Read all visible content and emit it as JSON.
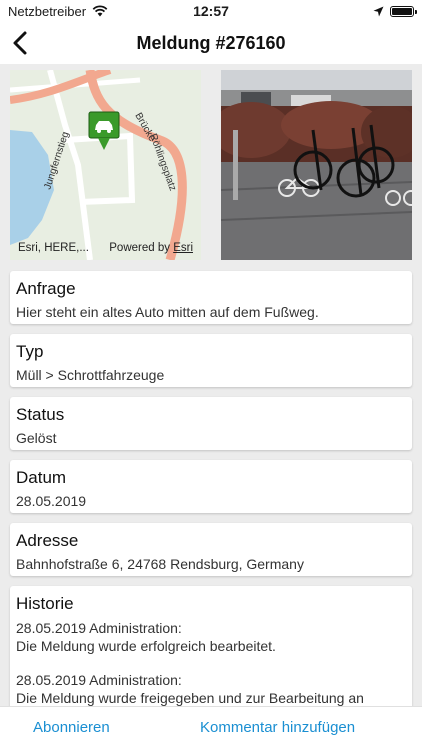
{
  "status_bar": {
    "carrier": "Netzbetreiber",
    "time": "12:57",
    "icons": [
      "wifi-icon",
      "location-arrow-icon",
      "battery-icon"
    ]
  },
  "nav": {
    "title": "Meldung #276160",
    "back_icon": "chevron-left-icon"
  },
  "map": {
    "street_labels": [
      "Jungfernstieg",
      "Brücke",
      "Röhlingsplatz"
    ],
    "attribution_left": "Esri, HERE,...",
    "attribution_powered": "Powered by ",
    "attribution_link": "Esri",
    "marker_icon": "car-marker-icon",
    "marker_color": "#3a9a2a"
  },
  "photo": {
    "subject": "bicycles-photo"
  },
  "cards": {
    "anfrage": {
      "title": "Anfrage",
      "value": "Hier steht ein altes Auto mitten auf dem Fußweg."
    },
    "typ": {
      "title": "Typ",
      "value": "Müll > Schrottfahrzeuge"
    },
    "status": {
      "title": "Status",
      "value": "Gelöst"
    },
    "datum": {
      "title": "Datum",
      "value": "28.05.2019"
    },
    "adresse": {
      "title": "Adresse",
      "value": "Bahnhofstraße 6, 24768 Rendsburg, Germany"
    },
    "historie": {
      "title": "Historie",
      "entries": [
        {
          "header": "28.05.2019 Administration:",
          "text": "Die Meldung wurde erfolgreich bearbeitet."
        },
        {
          "header": "28.05.2019 Administration:",
          "text": "Die Meldung wurde freigegeben und zur Bearbeitung an \"Administration\" weitergeleitet."
        }
      ]
    }
  },
  "bottom_bar": {
    "subscribe_label": "Abonnieren",
    "comment_label": "Kommentar hinzufügen"
  },
  "colors": {
    "accent": "#1a8fd2",
    "background": "#ececec"
  }
}
